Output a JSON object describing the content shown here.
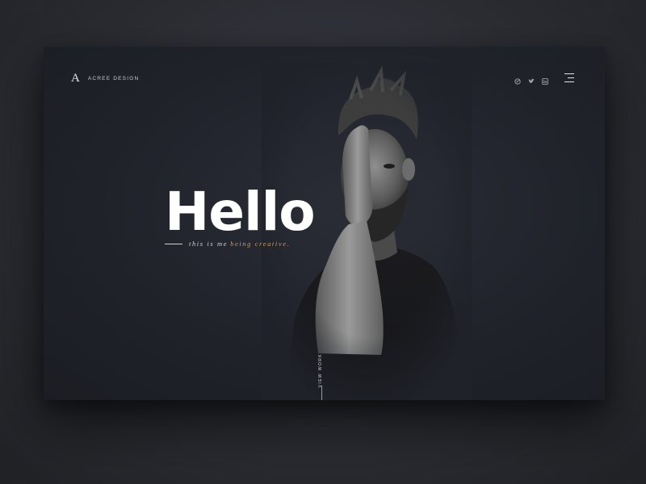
{
  "header": {
    "logo_mark": "A",
    "brand": "ACREE DESIGN",
    "social_icons": [
      "dribbble-icon",
      "twitter-icon",
      "linkedin-icon"
    ],
    "menu_icon": "hamburger-menu-icon"
  },
  "hero": {
    "title": "Hello",
    "tagline_prefix": "this is me",
    "tagline_accent": "being creative.",
    "cta": "VIEW WORK"
  },
  "colors": {
    "accent": "#c99a6c",
    "background": "#1f2229",
    "text": "#ffffff"
  }
}
